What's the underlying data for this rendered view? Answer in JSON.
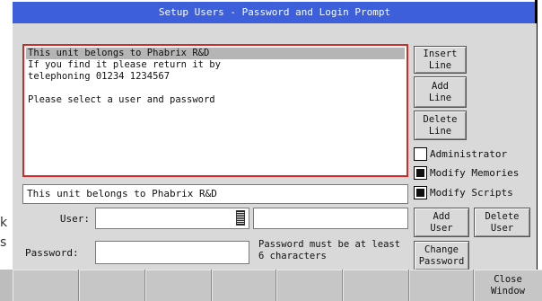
{
  "window": {
    "title": "Setup Users - Password and Login Prompt"
  },
  "message": {
    "lines": [
      "This unit belongs to Phabrix R&D",
      "If you find it please return it by",
      "telephoning 01234 1234567",
      "",
      "Please select a user and password"
    ],
    "selected_index": 0,
    "selected_line_value": "This unit belongs to Phabrix R&D"
  },
  "side_buttons": {
    "insert_line": "Insert Line",
    "add_line": "Add Line",
    "delete_line": "Delete Line"
  },
  "permissions": {
    "administrator": {
      "label": "Administrator",
      "checked": false
    },
    "modify_memories": {
      "label": "Modify Memories",
      "checked": true
    },
    "modify_scripts": {
      "label": "Modify Scripts",
      "checked": true
    }
  },
  "user": {
    "label": "User:",
    "value": "",
    "name_value": ""
  },
  "password": {
    "label": "Password:",
    "value": "",
    "note": "Password must be at least 6 characters"
  },
  "user_buttons": {
    "add_user": "Add User",
    "delete_user": "Delete User",
    "change_password": "Change Password"
  },
  "bottom_bar": {
    "close_window": "Close Window"
  },
  "edge_fragments": {
    "left_1": "k",
    "left_2": "s"
  },
  "colors": {
    "title_bar": "#3d5fd9",
    "dialog_bg": "#d9d9d9",
    "focus_border": "#d42a2a"
  }
}
